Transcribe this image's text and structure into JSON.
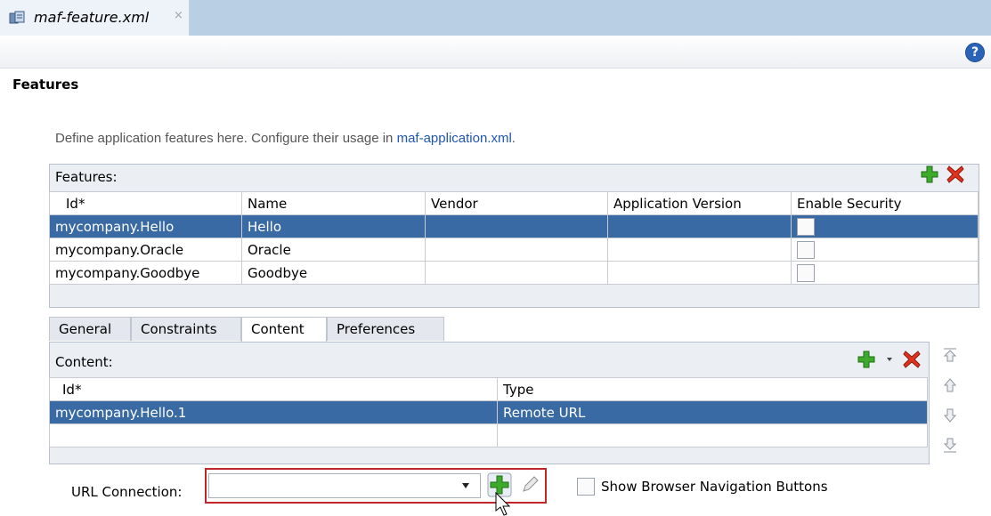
{
  "editor_tab": {
    "filename": "maf-feature.xml",
    "close": "×"
  },
  "help": {
    "label": "?"
  },
  "page_title": "Features",
  "description": {
    "prefix": "Define application features here. Configure their usage in ",
    "link": "maf-application.xml",
    "suffix": "."
  },
  "features": {
    "label": "Features:",
    "columns": [
      "Id*",
      "Name",
      "Vendor",
      "Application Version",
      "Enable Security"
    ],
    "rows": [
      {
        "id": "mycompany.Hello",
        "name": "Hello",
        "vendor": "",
        "app_version": "",
        "enable_security": false,
        "selected": true
      },
      {
        "id": "mycompany.Oracle",
        "name": "Oracle",
        "vendor": "",
        "app_version": "",
        "enable_security": false,
        "selected": false
      },
      {
        "id": "mycompany.Goodbye",
        "name": "Goodbye",
        "vendor": "",
        "app_version": "",
        "enable_security": false,
        "selected": false
      }
    ]
  },
  "tabs": [
    {
      "label": "General",
      "active": false
    },
    {
      "label": "Constraints",
      "active": false
    },
    {
      "label": "Content",
      "active": true
    },
    {
      "label": "Preferences",
      "active": false
    }
  ],
  "content": {
    "label": "Content:",
    "columns": [
      "Id*",
      "Type"
    ],
    "rows": [
      {
        "id": "mycompany.Hello.1",
        "type": "Remote URL",
        "selected": true
      }
    ]
  },
  "url_connection": {
    "label": "URL Connection:",
    "value": ""
  },
  "show_browser_nav": {
    "label": "Show Browser Navigation Buttons",
    "checked": false
  },
  "colors": {
    "selection": "#3a6aa3",
    "highlight_border": "#c0272d",
    "link": "#1f56b3",
    "tab_bar": "#b9cfe4"
  }
}
